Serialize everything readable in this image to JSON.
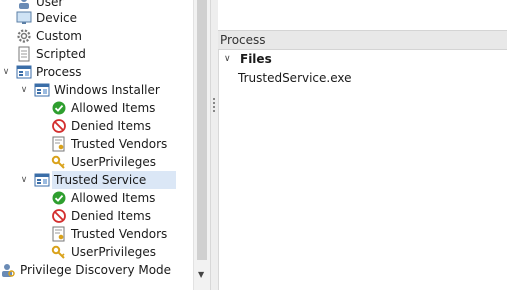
{
  "tree": {
    "user": "User",
    "device": "Device",
    "custom": "Custom",
    "scripted": "Scripted",
    "process": "Process",
    "windows_installer": "Windows Installer",
    "wi_allowed": "Allowed Items",
    "wi_denied": "Denied Items",
    "wi_vendors": "Trusted Vendors",
    "wi_privileges": "UserPrivileges",
    "trusted_service": "Trusted Service",
    "ts_allowed": "Allowed Items",
    "ts_denied": "Denied Items",
    "ts_vendors": "Trusted Vendors",
    "ts_privileges": "UserPrivileges",
    "discovery": "Privilege Discovery Mode"
  },
  "panel": {
    "header": "Process",
    "group": "Files",
    "items": [
      "TrustedService.exe"
    ]
  },
  "colors": {
    "selection": "#dbe7f6",
    "panel_header": "#e8e8e8",
    "allowed_green": "#2e9e2e",
    "denied_red": "#d32f2f"
  }
}
